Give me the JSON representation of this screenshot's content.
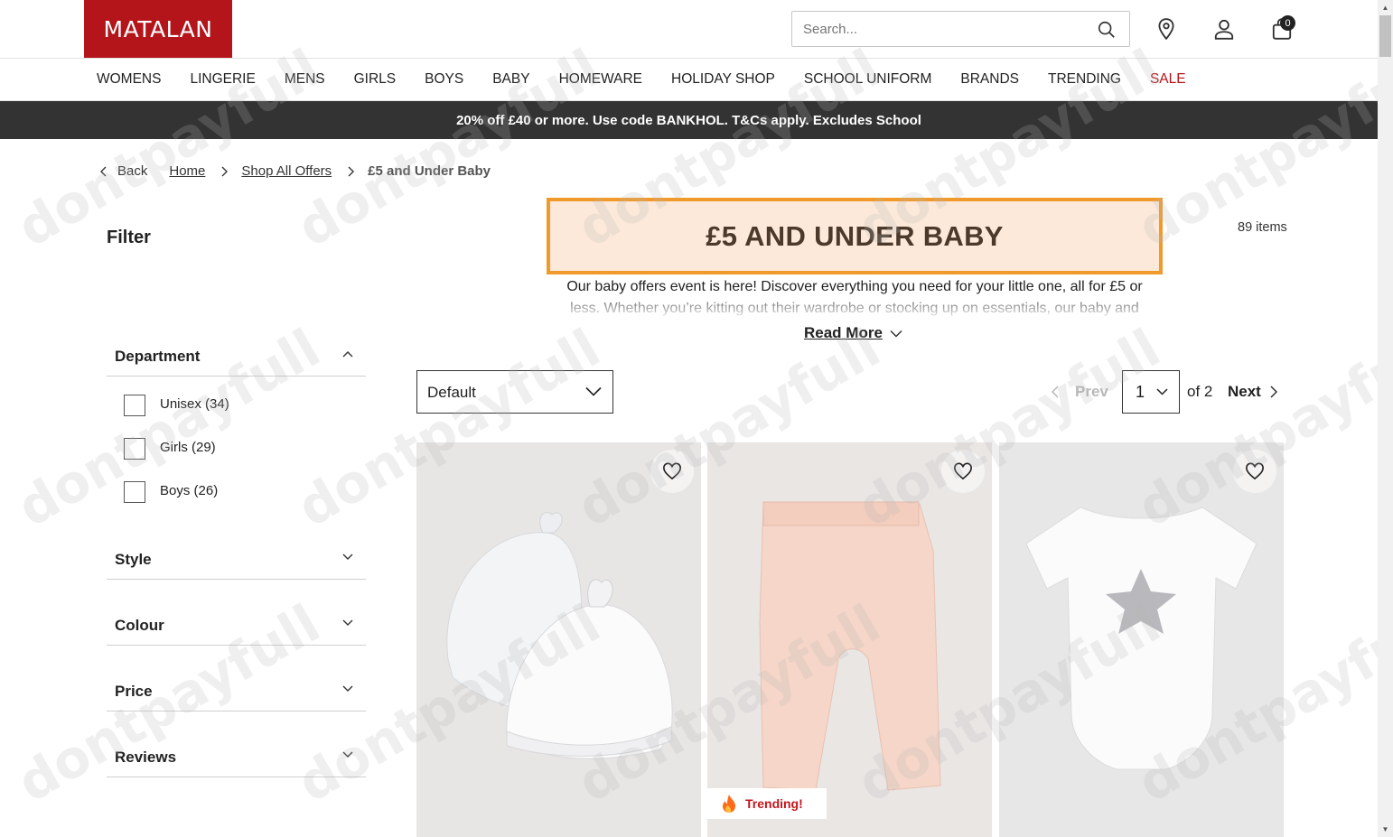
{
  "brand": {
    "name": "MATALAN",
    "color": "#b3151b"
  },
  "search": {
    "placeholder": "Search...",
    "icon": "search-icon"
  },
  "header": {
    "bag_count": "0",
    "icons": [
      "store-locator-icon",
      "account-icon",
      "bag-icon"
    ]
  },
  "nav": {
    "items": [
      "WOMENS",
      "LINGERIE",
      "MENS",
      "GIRLS",
      "BOYS",
      "BABY",
      "HOMEWARE",
      "HOLIDAY SHOP",
      "SCHOOL UNIFORM",
      "BRANDS",
      "TRENDING",
      "SALE"
    ]
  },
  "promo": {
    "text": "20% off £40 or more. Use code BANKHOL. T&Cs apply. Excludes School"
  },
  "breadcrumb": {
    "back": "Back",
    "home": "Home",
    "shop_all_offers": "Shop All Offers",
    "current": "£5 and Under Baby"
  },
  "page": {
    "title": "£5 AND UNDER BABY",
    "items_count": "89 items",
    "description": "Our baby offers event is here! Discover everything you need for your little one, all for £5 or less. Whether you’re kitting out their wardrobe or stocking up on essentials, our baby and",
    "read_more": "Read More"
  },
  "filter": {
    "title": "Filter",
    "facets": [
      "Department",
      "Style",
      "Colour",
      "Price",
      "Reviews"
    ],
    "department_options": [
      "Unisex (34)",
      "Girls (29)",
      "Boys (26)"
    ]
  },
  "sort": {
    "selected": "Default"
  },
  "pager": {
    "prev": "Prev",
    "page": "1",
    "of": "of 2",
    "next": "Next"
  },
  "products": [
    {
      "image": "baby-hats-image",
      "badge": ""
    },
    {
      "image": "baby-leggings-image",
      "badge": "Trending!"
    },
    {
      "image": "baby-bodysuit-image",
      "badge": ""
    }
  ],
  "watermark": "dontpayfull",
  "colors": {
    "promo_bg": "#333333",
    "banner_bg": "#fde9da",
    "banner_border": "#f09a2c",
    "sale": "#b3151b",
    "trend": "#c4161c"
  }
}
